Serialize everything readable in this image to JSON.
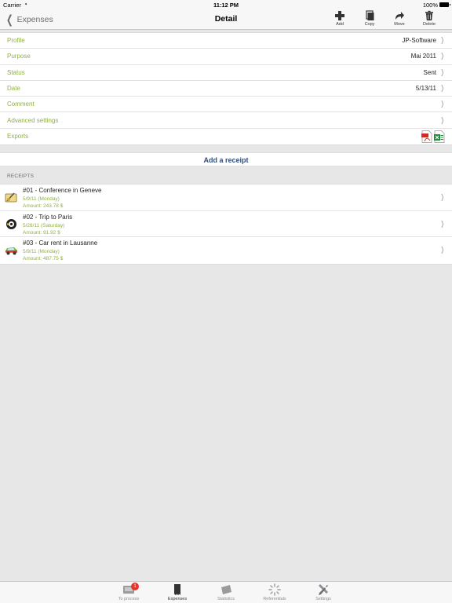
{
  "status_bar": {
    "carrier": "Carrier",
    "time": "11:12 PM",
    "battery": "100%"
  },
  "nav": {
    "back_label": "Expenses",
    "title": "Detail",
    "tools": [
      {
        "label": "Add",
        "icon": "plus-icon"
      },
      {
        "label": "Copy",
        "icon": "copy-icon"
      },
      {
        "label": "Move",
        "icon": "move-icon"
      },
      {
        "label": "Delete",
        "icon": "trash-icon"
      }
    ]
  },
  "details": [
    {
      "label": "Profile",
      "value": "JP-Software"
    },
    {
      "label": "Purpose",
      "value": "Mai 2011"
    },
    {
      "label": "Status",
      "value": "Sent"
    },
    {
      "label": "Date",
      "value": "5/13/11"
    },
    {
      "label": "Comment",
      "value": ""
    },
    {
      "label": "Advanced settings",
      "value": ""
    },
    {
      "label": "Exports",
      "value": ""
    }
  ],
  "add_receipt_label": "Add a receipt",
  "receipts_header": "RECEIPTS",
  "receipts": [
    {
      "title": "#01 - Conference in Geneve",
      "date": "5/9/11 (Monday)",
      "amount": "Amount: 243.78 $",
      "icon": "conference-icon"
    },
    {
      "title": "#02 - Trip to Paris",
      "date": "5/28/11 (Saturday)",
      "amount": "Amount: 91.92 $",
      "icon": "taxi-icon"
    },
    {
      "title": "#03 - Car rent in Lausanne",
      "date": "5/9/11 (Monday)",
      "amount": "Amount: 487.75 $",
      "icon": "car-icon"
    }
  ],
  "tabs": [
    {
      "label": "To process",
      "icon": "inbox-icon",
      "badge": "1"
    },
    {
      "label": "Expenses",
      "icon": "receipt-icon",
      "badge": ""
    },
    {
      "label": "Statistics",
      "icon": "statistics-icon",
      "badge": ""
    },
    {
      "label": "Referentials",
      "icon": "spinner-icon",
      "badge": ""
    },
    {
      "label": "Settings",
      "icon": "tools-icon",
      "badge": ""
    }
  ],
  "colors": {
    "accent_green": "#8fb046",
    "link_blue": "#2f4d7a",
    "badge_red": "#e5342b"
  }
}
